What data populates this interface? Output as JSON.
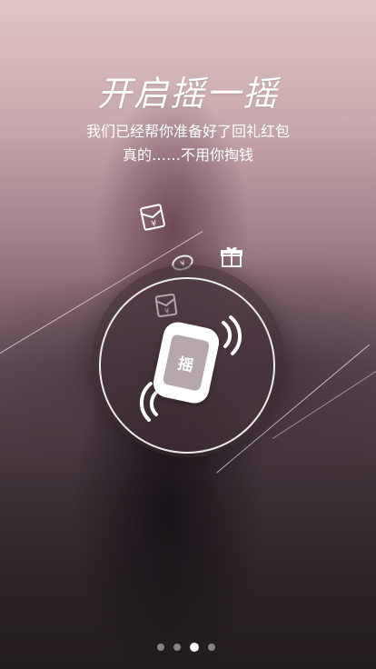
{
  "screen": {
    "title": "开启摇一摇",
    "subtitle_line1": "我们已经帮你准备好了回礼红包",
    "subtitle_line2": "真的……不用你掏钱",
    "phone_label": "摇"
  },
  "icons": {
    "red_envelope": "red-envelope-yuan-icon",
    "gift": "gift-icon",
    "coin": "coin-icon",
    "envelope_faint": "envelope-yuan-icon",
    "phone": "phone-shake-icon"
  },
  "pagination": {
    "total": 4,
    "active_index": 2
  },
  "colors": {
    "text": "#ffffff",
    "dot_inactive": "#ffffff73",
    "dot_active": "#ffffff"
  }
}
